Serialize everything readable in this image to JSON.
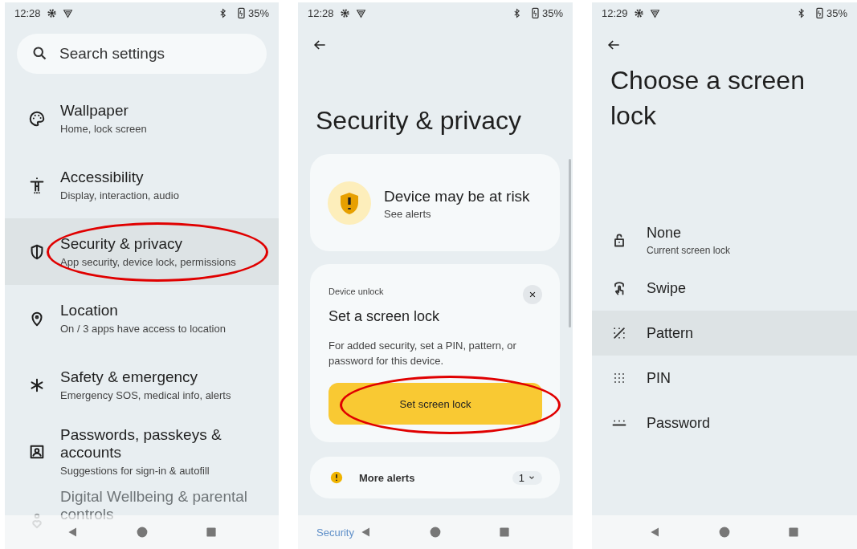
{
  "settings_screen": {
    "status_bar": {
      "time": "12:28",
      "battery": "35%"
    },
    "search": {
      "placeholder": "Search settings"
    },
    "items": [
      {
        "kind": "palette",
        "title": "Wallpaper",
        "subtitle": "Home, lock screen",
        "selected": false,
        "circled": false
      },
      {
        "kind": "accessibility",
        "title": "Accessibility",
        "subtitle": "Display, interaction, audio",
        "selected": false,
        "circled": false
      },
      {
        "kind": "shield",
        "title": "Security & privacy",
        "subtitle": "App security, device lock, permissions",
        "selected": true,
        "circled": true
      },
      {
        "kind": "location",
        "title": "Location",
        "subtitle": "On / 3 apps have access to location",
        "selected": false,
        "circled": false
      },
      {
        "kind": "asterisk",
        "title": "Safety & emergency",
        "subtitle": "Emergency SOS, medical info, alerts",
        "selected": false,
        "circled": false
      },
      {
        "kind": "account",
        "title": "Passwords, passkeys & accounts",
        "subtitle": "Suggestions for sign-in & autofill",
        "selected": false,
        "circled": false
      },
      {
        "kind": "wellbeing",
        "title": "Digital Wellbeing & parental controls",
        "selected": false,
        "circled": false
      }
    ]
  },
  "security_screen": {
    "status_bar": {
      "time": "12:28",
      "battery": "35%"
    },
    "title": "Security & privacy",
    "risk_card": {
      "title": "Device may be at risk",
      "subtitle": "See alerts"
    },
    "unlock_card": {
      "label": "Device unlock",
      "title": "Set a screen lock",
      "body": "For added security, set a PIN, pattern, or password for this device.",
      "button": "Set screen lock",
      "button_circled": true
    },
    "alerts_card": {
      "label": "More alerts",
      "count": "1"
    },
    "collapsed_title": "Security"
  },
  "screen_lock_screen": {
    "status_bar": {
      "time": "12:29",
      "battery": "35%"
    },
    "title": "Choose a screen lock",
    "options": [
      {
        "kind": "lock",
        "title": "None",
        "subtitle": "Current screen lock",
        "selected": false
      },
      {
        "kind": "swipe",
        "title": "Swipe",
        "selected": false
      },
      {
        "kind": "pattern",
        "title": "Pattern",
        "selected": true
      },
      {
        "kind": "pin",
        "title": "PIN",
        "selected": false
      },
      {
        "kind": "password",
        "title": "Password",
        "selected": false
      }
    ]
  }
}
